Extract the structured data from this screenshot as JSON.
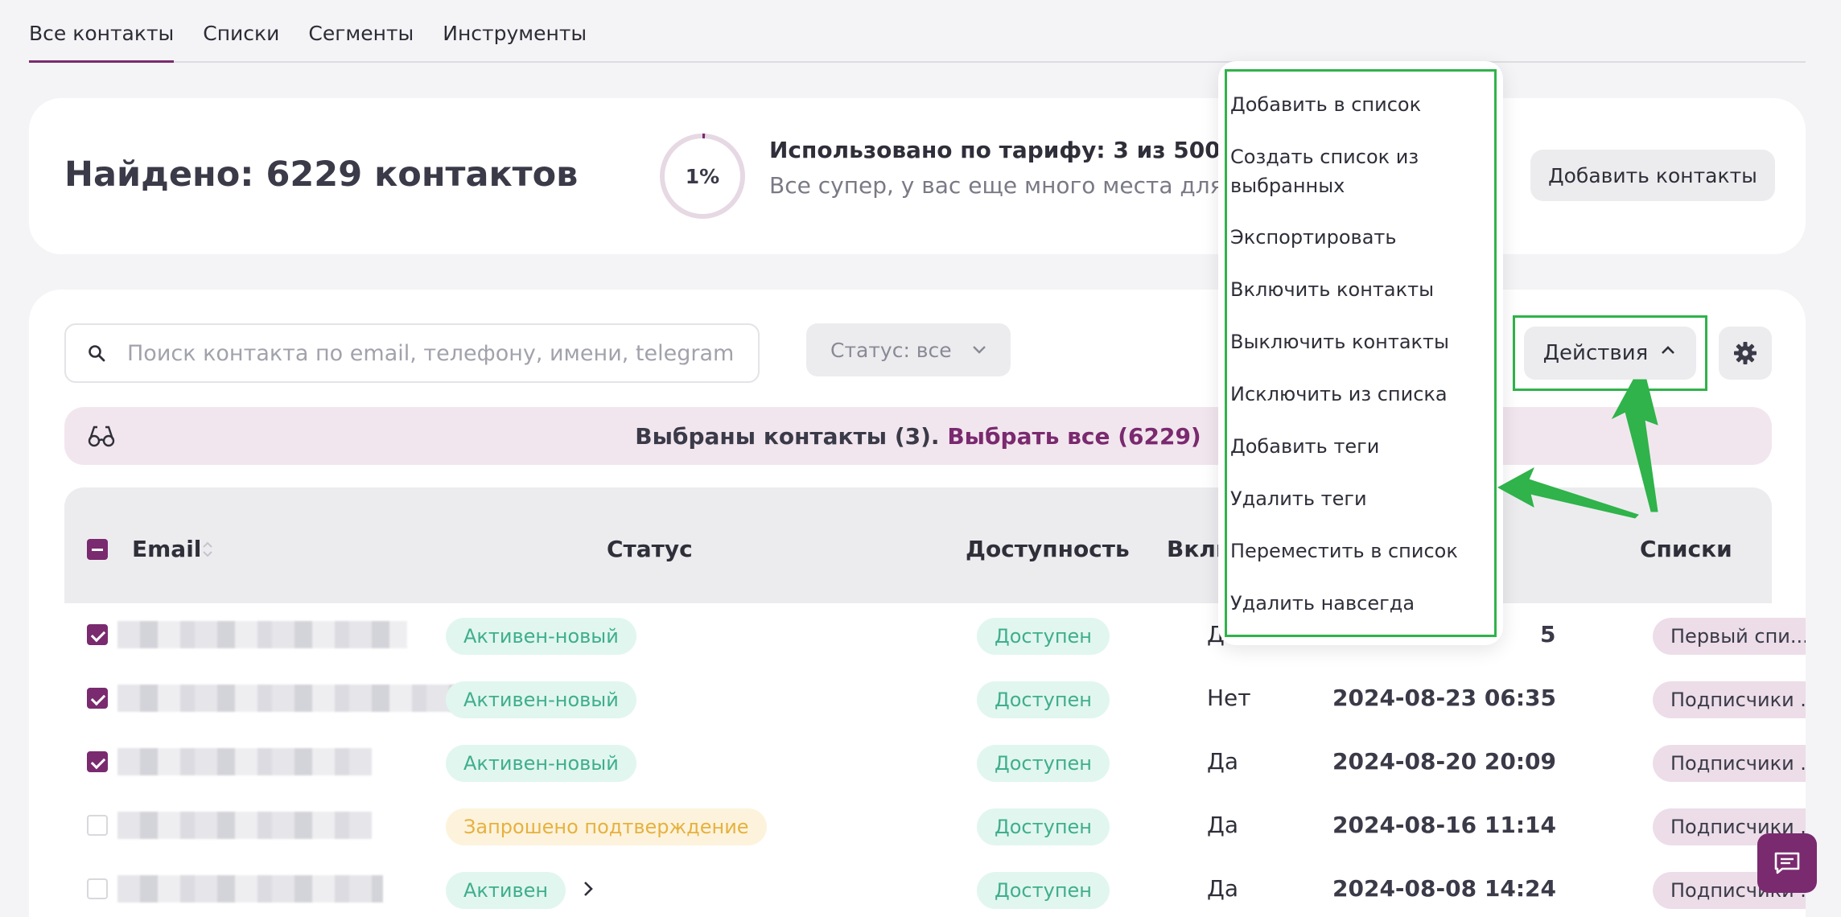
{
  "tabs": [
    {
      "label": "Все контакты",
      "active": true
    },
    {
      "label": "Списки"
    },
    {
      "label": "Сегменты"
    },
    {
      "label": "Инструменты"
    }
  ],
  "summary": {
    "found_title": "Найдено: 6229 контактов",
    "progress_percent": "1%",
    "progress_value": 0.01,
    "usage_line1": "Использовано по тарифу: 3 из 500 конт",
    "usage_line2": "Все супер, у вас еще много места для",
    "add_contacts_label": "Добавить контакты"
  },
  "toolbar": {
    "search_placeholder": "Поиск контакта по email, телефону, имени, telegram",
    "status_filter": "Статус: все",
    "actions_label": "Действия"
  },
  "selection": {
    "text": "Выбраны контакты (3).",
    "select_all": "Выбрать все (6229)"
  },
  "table": {
    "headers": {
      "email": "Email",
      "status": "Статус",
      "availability": "Доступность",
      "enabled": "Вклю",
      "lists": "Списки"
    },
    "rows": [
      {
        "checked": true,
        "status": "Активен-новый",
        "status_color": "green",
        "availability": "Доступен",
        "enabled": "Да",
        "date": "5",
        "list": "Первый спи..."
      },
      {
        "checked": true,
        "status": "Активен-новый",
        "status_color": "green",
        "availability": "Доступен",
        "enabled": "Нет",
        "date": "2024-08-23 06:35",
        "list": "Подписчики ..."
      },
      {
        "checked": true,
        "status": "Активен-новый",
        "status_color": "green",
        "availability": "Доступен",
        "enabled": "Да",
        "date": "2024-08-20 20:09",
        "list": "Подписчики ..."
      },
      {
        "checked": false,
        "status": "Запрошено подтверждение",
        "status_color": "yellow",
        "availability": "Доступен",
        "enabled": "Да",
        "date": "2024-08-16 11:14",
        "list": "Подписчики ..."
      },
      {
        "checked": false,
        "status": "Активен",
        "status_color": "green",
        "availability": "Доступен",
        "enabled": "Да",
        "date": "2024-08-08 14:24",
        "list": "Подписчики ..."
      }
    ]
  },
  "actions_menu": [
    "Добавить в список",
    "Создать список из выбранных",
    "Экспортировать",
    "Включить контакты",
    "Выключить контакты",
    "Исключить из списка",
    "Добавить теги",
    "Удалить теги",
    "Переместить в список",
    "Удалить навсегда"
  ],
  "colors": {
    "accent": "#7a2a6f",
    "highlight": "#2fb34a",
    "badge_green": "#3fae8c",
    "badge_yellow": "#e6b13f"
  }
}
